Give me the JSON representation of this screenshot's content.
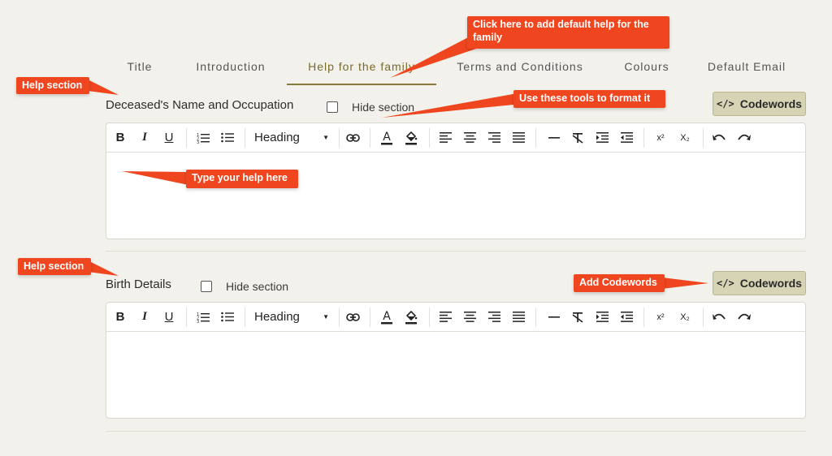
{
  "tabs": [
    {
      "label": "Title",
      "active": false
    },
    {
      "label": "Introduction",
      "active": false
    },
    {
      "label": "Help for the family",
      "active": true
    },
    {
      "label": "Terms and Conditions",
      "active": false
    },
    {
      "label": "Colours",
      "active": false
    },
    {
      "label": "Default Email",
      "active": false
    }
  ],
  "sections": [
    {
      "title": "Deceased's Name and Occupation",
      "hide_label": "Hide section",
      "hide_checked": false,
      "codewords_label": "Codewords",
      "heading_value": "Heading"
    },
    {
      "title": "Birth Details",
      "hide_label": "Hide section",
      "hide_checked": false,
      "codewords_label": "Codewords",
      "heading_value": "Heading"
    }
  ],
  "toolbar_icons": [
    "bold-icon",
    "italic-icon",
    "underline-icon",
    "ordered-list-icon",
    "bullet-list-icon",
    "heading-select",
    "link-icon",
    "font-color-icon",
    "highlight-icon",
    "align-left-icon",
    "align-center-icon",
    "align-right-icon",
    "align-justify-icon",
    "horizontal-rule-icon",
    "clear-format-icon",
    "indent-icon",
    "outdent-icon",
    "superscript-icon",
    "subscript-icon",
    "undo-icon",
    "redo-icon"
  ],
  "toolbar_glyphs": {
    "bold": "B",
    "italic": "I",
    "underline": "U",
    "superscript": "x²",
    "subscript": "X₂"
  },
  "codewords_icon": "</>",
  "callouts": {
    "help_section_1": "Help section",
    "help_section_2": "Help section",
    "tab_hint": "Click here to add default help for the family",
    "tools_hint": "Use these tools to format it",
    "type_hint": "Type your help here",
    "codewords_hint": "Add Codewords"
  },
  "colors": {
    "accent": "#8a7b3a",
    "callout": "#f0461f",
    "codewords_bg": "#d6d4b4",
    "page_bg": "#f3f1ec"
  }
}
